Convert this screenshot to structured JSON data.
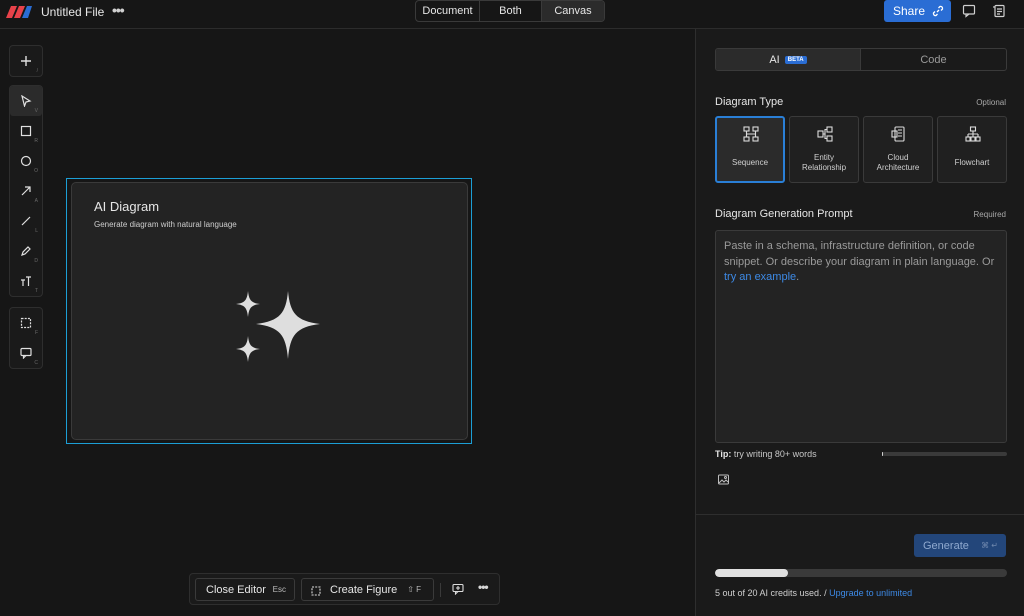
{
  "header": {
    "file_title": "Untitled File",
    "more_label": "•••",
    "view_modes": [
      "Document",
      "Both",
      "Canvas"
    ],
    "active_view": "Canvas",
    "share_label": "Share"
  },
  "toolbar": {
    "tools": [
      {
        "name": "add",
        "key": "/"
      },
      {
        "name": "select",
        "key": "V"
      },
      {
        "name": "rectangle",
        "key": "R"
      },
      {
        "name": "ellipse",
        "key": "O"
      },
      {
        "name": "arrow",
        "key": "A"
      },
      {
        "name": "line",
        "key": "L"
      },
      {
        "name": "pencil",
        "key": "D"
      },
      {
        "name": "text",
        "key": "T"
      },
      {
        "name": "frame",
        "key": "F"
      },
      {
        "name": "comment",
        "key": "C"
      }
    ]
  },
  "canvas": {
    "card_title": "AI Diagram",
    "card_subtitle": "Generate diagram with natural language"
  },
  "bottom_bar": {
    "close_label": "Close Editor",
    "close_key": "Esc",
    "create_label": "Create Figure",
    "create_key": "⇧ F",
    "more_label": "•••"
  },
  "panel": {
    "tabs": {
      "ai": "AI",
      "beta": "BETA",
      "code": "Code"
    },
    "diagram_type_label": "Diagram Type",
    "diagram_type_hint": "Optional",
    "diagram_types": [
      {
        "label": "Sequence",
        "selected": true
      },
      {
        "label": "Entity Relationship",
        "selected": false
      },
      {
        "label": "Cloud Architecture",
        "selected": false
      },
      {
        "label": "Flowchart",
        "selected": false
      }
    ],
    "prompt_label": "Diagram Generation Prompt",
    "prompt_hint": "Required",
    "prompt_placeholder_a": "Paste in a schema, infrastructure definition, or code snippet. Or describe your diagram in plain language. Or ",
    "prompt_placeholder_link": "try an example",
    "prompt_placeholder_b": ".",
    "tip_bold": "Tip:",
    "tip_text": " try writing 80+ words",
    "tip_progress": 0.01,
    "generate_label": "Generate",
    "generate_key": "⌘ ↵",
    "credits_used": 5,
    "credits_total": 20,
    "credits_text": "5 out of 20 AI credits used. / ",
    "upgrade_label": "Upgrade to unlimited"
  },
  "colors": {
    "accent": "#2a6dd4",
    "selection": "#1c9fd6",
    "background": "#161616"
  }
}
